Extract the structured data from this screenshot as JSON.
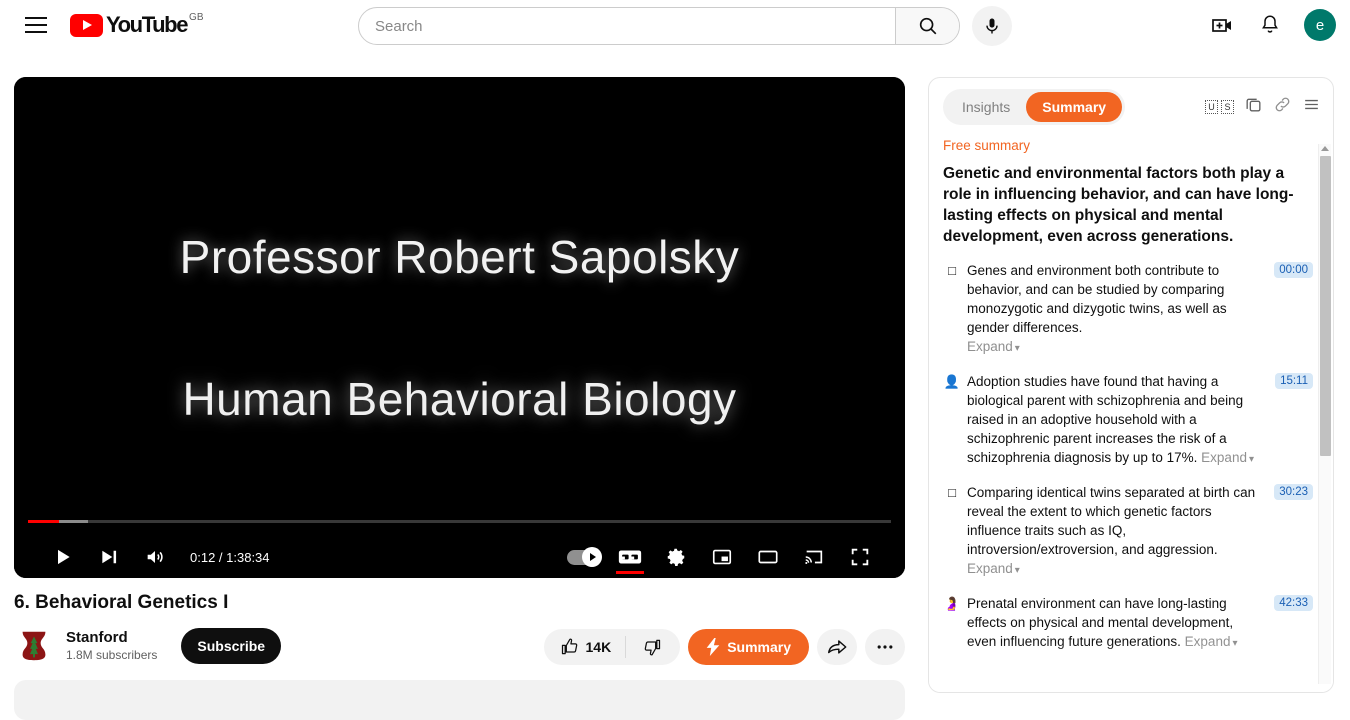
{
  "header": {
    "menu_label": "Guide menu",
    "logo_text": "YouTube",
    "country_code": "GB",
    "search": {
      "value": "",
      "placeholder": "Search"
    },
    "mic_label": "Search with your voice",
    "create_label": "Create",
    "notifications_label": "Notifications",
    "avatar_initial": "e"
  },
  "player": {
    "video_line1": "Professor Robert Sapolsky",
    "video_line2": "Human Behavioral Biology",
    "time_display": "0:12 / 1:38:34",
    "current_time": "0:12",
    "duration": "1:38:34",
    "play_label": "Play",
    "next_label": "Next",
    "volume_label": "Mute",
    "autoplay_label": "Autoplay is on",
    "subtitles_label": "Subtitles/closed captions (c)",
    "settings_label": "Settings",
    "miniplayer_label": "Miniplayer (i)",
    "theater_label": "Theater mode (t)",
    "cast_label": "Play on TV",
    "fullscreen_label": "Full screen (f)"
  },
  "video": {
    "title": "6. Behavioral Genetics I",
    "channel_name": "Stanford",
    "subscribers": "1.8M subscribers",
    "subscribe_label": "Subscribe",
    "like_count": "14K",
    "dislike_label": "Dislike",
    "summary_label": "Summary",
    "share_label": "Share",
    "more_label": "More actions"
  },
  "panel": {
    "tabs": [
      {
        "label": "Insights",
        "active": false
      },
      {
        "label": "Summary",
        "active": true
      }
    ],
    "icons": {
      "lang_u": "U",
      "lang_s": "S",
      "copy_label": "Copy",
      "link_label": "Copy link",
      "menu_label": "Menu"
    },
    "free_summary_label": "Free summary",
    "headline": "Genetic and environmental factors both play a role in influencing behavior, and can have long-lasting effects on physical and mental development, even across generations.",
    "expand_label": "Expand",
    "items": [
      {
        "emoji": "□",
        "emoji_name": "white-square-icon",
        "text": "Genes and environment both contribute to behavior, and can be studied by comparing monozygotic and dizygotic twins, as well as gender differences.",
        "timestamp": "00:00",
        "expand_inline": false,
        "faded": false
      },
      {
        "emoji": "👤",
        "emoji_name": "person-silhouette-icon",
        "text": "Adoption studies have found that having a biological parent with schizophrenia and being raised in an adoptive household with a schizophrenic parent increases the risk of a schizophrenia diagnosis by up to 17%.",
        "timestamp": "15:11",
        "expand_inline": true,
        "faded": false
      },
      {
        "emoji": "□",
        "emoji_name": "white-square-icon",
        "text": "Comparing identical twins separated at birth can reveal the extent to which genetic factors influence traits such as IQ, introversion/extroversion, and aggression.",
        "timestamp": "30:23",
        "expand_inline": true,
        "faded": false
      },
      {
        "emoji": "🤰",
        "emoji_name": "pregnant-person-icon",
        "text": "Prenatal environment can have long-lasting effects on physical and mental development, even influencing future generations.",
        "timestamp": "42:33",
        "expand_inline": true,
        "faded": true
      }
    ]
  },
  "colors": {
    "brand_red": "#ff0000",
    "accent_orange": "#f26522",
    "avatar_teal": "#00796b",
    "timestamp_bg": "#d7e8f7",
    "timestamp_fg": "#1a5fb4"
  }
}
